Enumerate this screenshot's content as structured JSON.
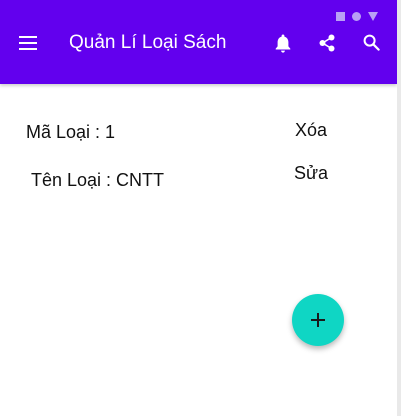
{
  "app_bar": {
    "title": "Quản Lí Loại Sách",
    "background_color": "#6200ee",
    "menu_icon": "menu-icon",
    "actions": [
      "bell-icon",
      "share-icon",
      "search-icon"
    ]
  },
  "status_bar": {
    "icons": [
      "square-icon",
      "circle-icon",
      "triangle-icon"
    ]
  },
  "item": {
    "code_label": "Mã Loại : 1",
    "name_label": "Tên Loại : CNTT",
    "delete_label": "Xóa",
    "edit_label": "Sửa"
  },
  "fab": {
    "icon": "plus-icon",
    "color": "#0fd6c4"
  }
}
